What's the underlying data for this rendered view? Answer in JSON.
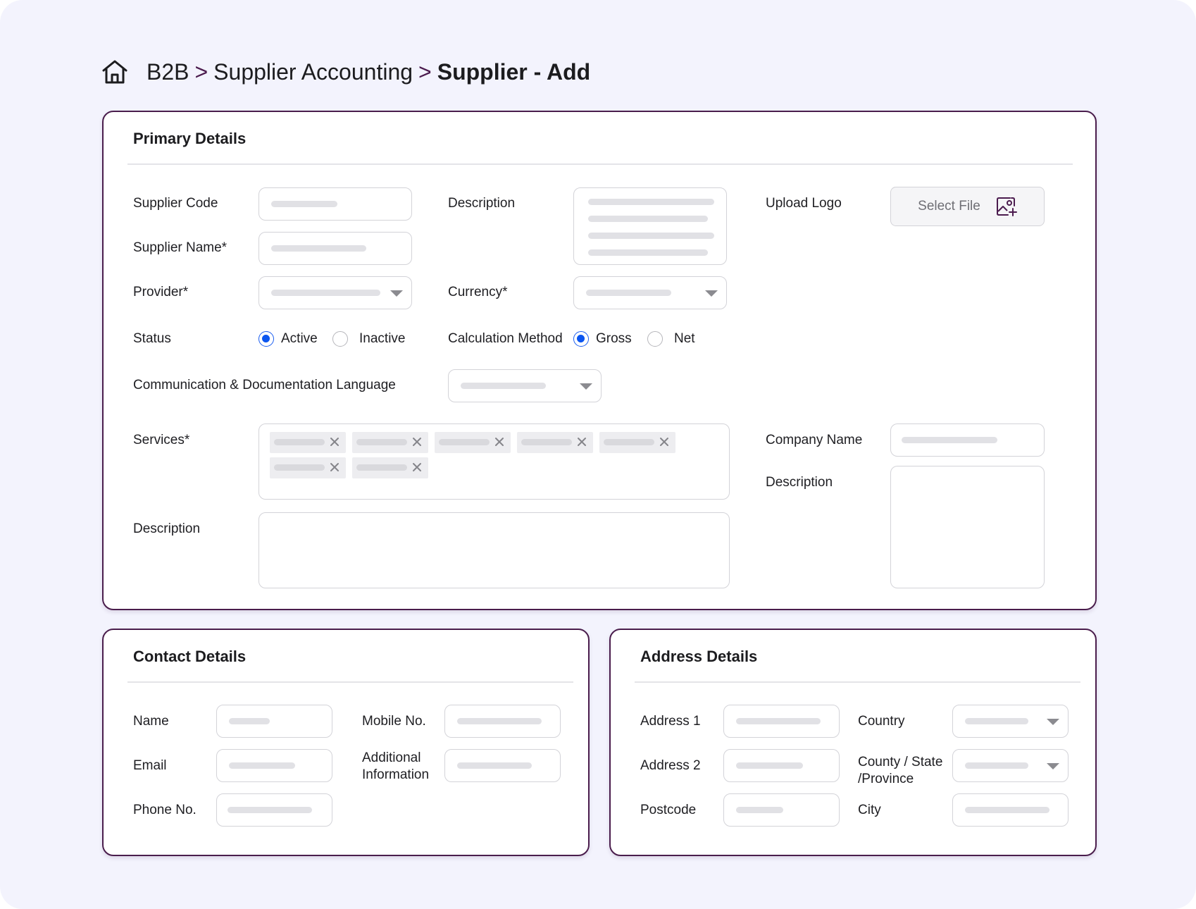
{
  "breadcrumb": {
    "items": [
      "B2B",
      "Supplier Accounting"
    ],
    "current": "Supplier - Add",
    "separator": ">"
  },
  "primary": {
    "title": "Primary Details",
    "supplier_code_label": "Supplier Code",
    "supplier_name_label": "Supplier Name*",
    "provider_label": "Provider*",
    "status_label": "Status",
    "status_options": [
      "Active",
      "Inactive"
    ],
    "status_selected": "Active",
    "description_label": "Description",
    "currency_label": "Currency*",
    "calc_method_label": "Calculation Method",
    "calc_options": [
      "Gross",
      "Net"
    ],
    "calc_selected": "Gross",
    "upload_logo_label": "Upload Logo",
    "select_file_label": "Select File",
    "language_label": "Communication & Documentation Language",
    "services_label": "Services*",
    "services_description_label": "Description",
    "company_name_label": "Company Name",
    "company_description_label": "Description"
  },
  "contact": {
    "title": "Contact Details",
    "name_label": "Name",
    "email_label": "Email",
    "phone_label": "Phone No.",
    "mobile_label": "Mobile No.",
    "additional_label_line1": "Additional",
    "additional_label_line2": "Information"
  },
  "address": {
    "title": "Address Details",
    "address1_label": "Address 1",
    "address2_label": "Address 2",
    "postcode_label": "Postcode",
    "country_label": "Country",
    "county_label_line1": "County / State",
    "county_label_line2": "/Province",
    "city_label": "City"
  },
  "colors": {
    "page_bg": "#f3f3fd",
    "card_border": "#4a1d4c",
    "radio_selected": "#0a55f0"
  },
  "icons": [
    "home-icon",
    "image-add-icon",
    "close-icon",
    "chevron-down-icon"
  ]
}
